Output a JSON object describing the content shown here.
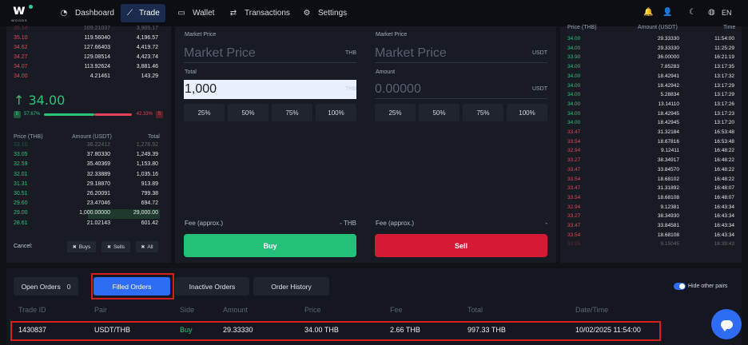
{
  "brand": {
    "word": "WOODS"
  },
  "nav": {
    "items": [
      {
        "label": "Dashboard",
        "icon": "gauge-icon"
      },
      {
        "label": "Trade",
        "icon": "chart-line-icon"
      },
      {
        "label": "Wallet",
        "icon": "wallet-icon"
      },
      {
        "label": "Transactions",
        "icon": "arrows-swap-icon"
      },
      {
        "label": "Settings",
        "icon": "gear-icon"
      }
    ],
    "active": "Trade",
    "language": "EN",
    "right_icons": [
      "bell-icon",
      "user-icon",
      "moon-icon",
      "globe-icon"
    ]
  },
  "orderbook": {
    "asks": [
      {
        "price": "35.14",
        "amount": "109.21037",
        "total": "3,905.17"
      },
      {
        "price": "35.10",
        "amount": "119.56040",
        "total": "4,196.57"
      },
      {
        "price": "34.62",
        "amount": "127.66403",
        "total": "4,419.72"
      },
      {
        "price": "34.27",
        "amount": "129.08514",
        "total": "4,423.74"
      },
      {
        "price": "34.07",
        "amount": "113.92624",
        "total": "3,881.46"
      },
      {
        "price": "34.00",
        "amount": "4.21461",
        "total": "143.29"
      }
    ],
    "last_price": "34.00",
    "last_price_arrow": "↑",
    "buy_ratio": "57.67%",
    "sell_ratio": "42.33%",
    "buy_tag": "B",
    "sell_tag": "S",
    "headers": {
      "price": "Price (THB)",
      "amount": "Amount (USDT)",
      "total": "Total"
    },
    "bids": [
      {
        "price": "33.10",
        "amount": "36.22412",
        "total": "1,276.92"
      },
      {
        "price": "33.05",
        "amount": "37.80330",
        "total": "1,249.39"
      },
      {
        "price": "32.59",
        "amount": "35.40369",
        "total": "1,153.80"
      },
      {
        "price": "32.01",
        "amount": "32.33889",
        "total": "1,035.16"
      },
      {
        "price": "31.31",
        "amount": "29.18870",
        "total": "913.89"
      },
      {
        "price": "30.51",
        "amount": "26.20091",
        "total": "799.38"
      },
      {
        "price": "29.60",
        "amount": "23.47046",
        "total": "694.72"
      },
      {
        "price": "29.00",
        "amount": "1,000.00000",
        "total": "29,000.00"
      },
      {
        "price": "28.61",
        "amount": "21.02143",
        "total": "601.42"
      }
    ],
    "cancel": {
      "label": "Cancel:",
      "buys": "Buys",
      "sells": "Sells",
      "all": "All"
    }
  },
  "buy_form": {
    "price_label": "Market Price",
    "price_value": "Market Price",
    "price_unit": "THB",
    "total_label": "Total",
    "total_value": "1,000",
    "total_unit": "THB",
    "percents": [
      "25%",
      "50%",
      "75%",
      "100%"
    ],
    "fee_label": "Fee (approx.)",
    "fee_value": "- THB",
    "button": "Buy"
  },
  "sell_form": {
    "price_label": "Market Price",
    "price_value": "Market Price",
    "price_unit": "USDT",
    "amount_label": "Amount",
    "amount_value": "0.00000",
    "amount_unit": "USDT",
    "percents": [
      "25%",
      "50%",
      "75%",
      "100%"
    ],
    "fee_label": "Fee (approx.)",
    "fee_value": "-",
    "button": "Sell"
  },
  "trades": {
    "headers": {
      "price": "Price (THB)",
      "amount": "Amount (USDT)",
      "time": "Time"
    },
    "rows": [
      {
        "price": "34.00",
        "amount": "29.33330",
        "time": "11:54:00",
        "side": "buy"
      },
      {
        "price": "34.00",
        "amount": "29.33330",
        "time": "11:25:29",
        "side": "buy"
      },
      {
        "price": "33.90",
        "amount": "36.00000",
        "time": "16:21:19",
        "side": "buy"
      },
      {
        "price": "34.00",
        "amount": "7.85283",
        "time": "13:17:35",
        "side": "buy"
      },
      {
        "price": "34.00",
        "amount": "18.42941",
        "time": "13:17:32",
        "side": "buy"
      },
      {
        "price": "34.00",
        "amount": "18.42942",
        "time": "13:17:29",
        "side": "buy"
      },
      {
        "price": "34.00",
        "amount": "5.28834",
        "time": "13:17:29",
        "side": "buy"
      },
      {
        "price": "34.00",
        "amount": "13.14110",
        "time": "13:17:26",
        "side": "buy"
      },
      {
        "price": "34.00",
        "amount": "18.42945",
        "time": "13:17:23",
        "side": "buy"
      },
      {
        "price": "34.00",
        "amount": "18.42945",
        "time": "13:17:20",
        "side": "buy"
      },
      {
        "price": "33.47",
        "amount": "31.32184",
        "time": "16:53:48",
        "side": "sell"
      },
      {
        "price": "33.54",
        "amount": "18.67816",
        "time": "16:53:48",
        "side": "sell"
      },
      {
        "price": "32.94",
        "amount": "9.12411",
        "time": "16:48:22",
        "side": "sell"
      },
      {
        "price": "33.27",
        "amount": "38.34917",
        "time": "16:48:22",
        "side": "sell"
      },
      {
        "price": "33.47",
        "amount": "33.84570",
        "time": "16:48:22",
        "side": "sell"
      },
      {
        "price": "33.54",
        "amount": "18.68102",
        "time": "16:48:22",
        "side": "sell"
      },
      {
        "price": "33.47",
        "amount": "31.31892",
        "time": "16:48:07",
        "side": "sell"
      },
      {
        "price": "33.54",
        "amount": "18.68108",
        "time": "16:48:07",
        "side": "sell"
      },
      {
        "price": "32.94",
        "amount": "9.12381",
        "time": "16:43:34",
        "side": "sell"
      },
      {
        "price": "33.27",
        "amount": "38.34930",
        "time": "16:43:34",
        "side": "sell"
      },
      {
        "price": "33.47",
        "amount": "33.84581",
        "time": "16:43:34",
        "side": "sell"
      },
      {
        "price": "33.54",
        "amount": "18.68108",
        "time": "16:43:34",
        "side": "sell"
      },
      {
        "price": "32.95",
        "amount": "9.15045",
        "time": "16:39:43",
        "side": "sell"
      }
    ]
  },
  "orders": {
    "tabs": [
      {
        "label": "Open Orders",
        "count": "0"
      },
      {
        "label": "Filled Orders"
      },
      {
        "label": "Inactive Orders"
      },
      {
        "label": "Order History"
      }
    ],
    "active_tab": "Filled Orders",
    "hide_other_pairs_label": "Hide other pairs",
    "hide_other_pairs": true,
    "columns": [
      "Trade ID",
      "Pair",
      "Side",
      "Amount",
      "Price",
      "Fee",
      "Total",
      "Date/Time"
    ],
    "rows": [
      {
        "trade_id": "1430837",
        "pair": "USDT/THB",
        "side": "Buy",
        "amount": "29.33330",
        "price": "34.00 THB",
        "fee": "2.66 THB",
        "total": "997.33 THB",
        "datetime": "10/02/2025 11:54:00"
      }
    ]
  },
  "colors": {
    "accent": "#2e6cf6",
    "buy": "#2bc37a",
    "sell": "#e2455a",
    "highlight": "#d61e1e"
  }
}
